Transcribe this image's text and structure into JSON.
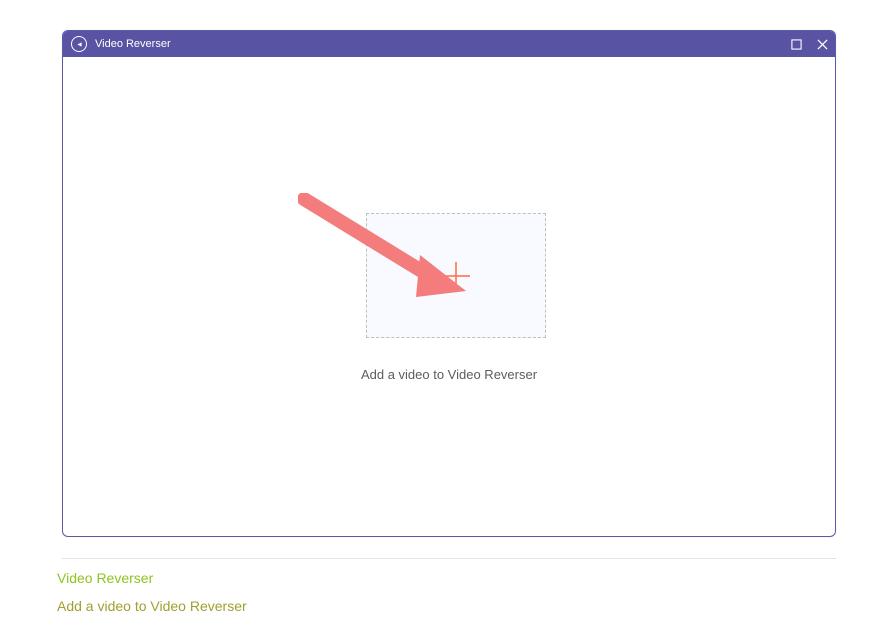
{
  "window": {
    "title": "Video Reverser"
  },
  "main": {
    "dropzone_caption": "Add a video to Video Reverser"
  },
  "captions": {
    "line1": "Video Reverser",
    "line2": "Add a video to Video Reverser"
  },
  "icons": {
    "app": "play-circle-icon",
    "maximize": "maximize-icon",
    "close": "close-icon",
    "plus": "plus-icon",
    "arrow": "annotation-arrow"
  },
  "colors": {
    "titlebar": "#5854a3",
    "arrow": "#f47c7c",
    "plus": "#ff6a3d",
    "caption_green": "#8fc320"
  }
}
